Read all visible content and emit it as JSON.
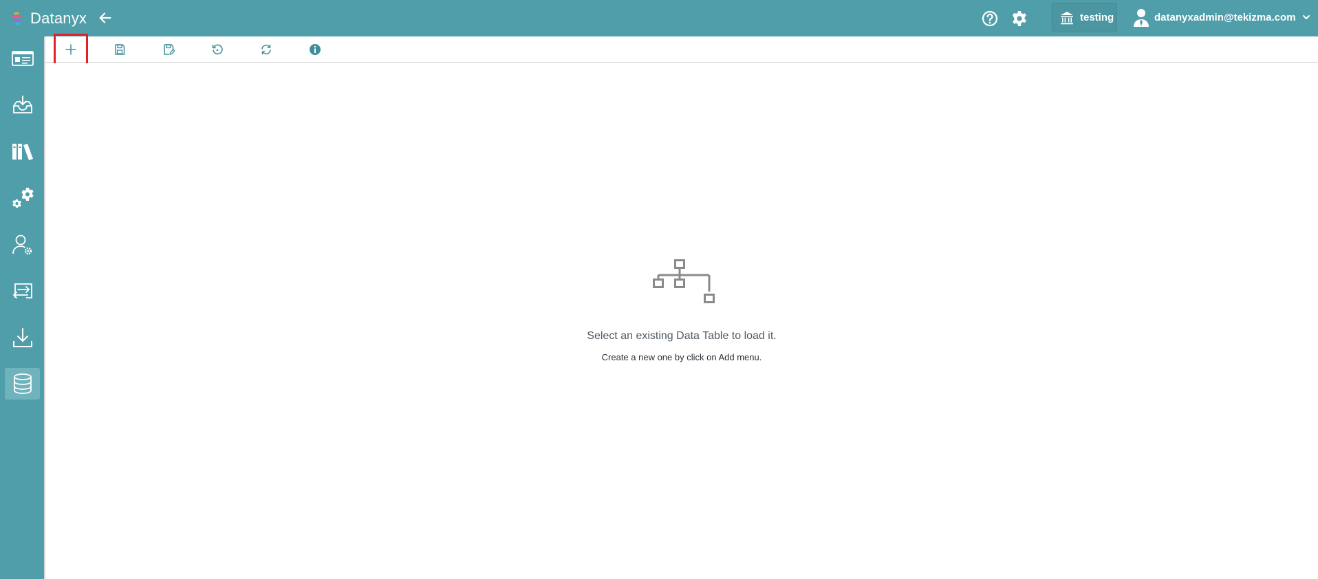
{
  "header": {
    "brand": "Datanyx",
    "tenant": "testing",
    "user_email": "datanyxadmin@tekizma.com"
  },
  "icons": {
    "logo": "datanyx-logo-icon",
    "back": "arrow-left-icon",
    "help": "help-circle-icon",
    "settings": "gear-icon",
    "tenant": "bank-building-icon",
    "user": "user-avatar-icon",
    "dropdown": "chevron-down-icon"
  },
  "sidebar": {
    "items": [
      {
        "name": "dashboard-card-icon",
        "active": false
      },
      {
        "name": "inbox-download-icon",
        "active": false
      },
      {
        "name": "library-books-icon",
        "active": false
      },
      {
        "name": "gears-icon",
        "active": false
      },
      {
        "name": "user-settings-icon",
        "active": false
      },
      {
        "name": "transfer-arrows-icon",
        "active": false
      },
      {
        "name": "download-icon",
        "active": false
      },
      {
        "name": "database-icon",
        "active": true
      }
    ]
  },
  "toolbar": {
    "buttons": [
      "add-icon",
      "save-icon",
      "save-as-icon",
      "reset-icon",
      "refresh-icon",
      "info-icon"
    ],
    "highlighted": "add-icon"
  },
  "empty_state": {
    "title": "Select an existing Data Table to load it.",
    "subtitle": "Create a new one by click on Add menu."
  },
  "colors": {
    "header_bg": "#509ea9",
    "sidebar_active": "#6fb3bc",
    "toolbar_icon": "#3f8f9a",
    "highlight_border": "#e0212b",
    "empty_icon": "#8a8a8a"
  }
}
